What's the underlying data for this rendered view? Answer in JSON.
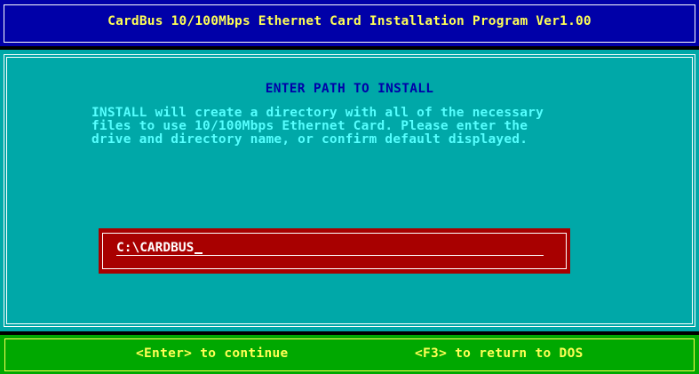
{
  "window": {
    "title": "CardBus 10/100Mbps Ethernet Card Installation Program Ver1.00"
  },
  "main": {
    "heading": "ENTER PATH TO INSTALL",
    "description_lines": [
      "INSTALL will create a directory with all of the necessary",
      "files to use 10/100Mbps Ethernet Card. Please enter the",
      "drive and directory name, or confirm default displayed."
    ],
    "path_input": {
      "value": "C:\\CARDBUS"
    }
  },
  "footer": {
    "continue_label": "<Enter> to continue",
    "dos_label": "<F3> to return to DOS"
  },
  "colors": {
    "title_bg": "#0000a8",
    "title_text": "#ffff55",
    "panel_bg": "#00a8a8",
    "heading_text": "#0000a8",
    "description_text": "#55ffff",
    "input_bg": "#a80000",
    "input_text": "#ffffff",
    "footer_bg": "#00a800",
    "footer_text": "#ffff55"
  },
  "icons": {
    "cursor": "text-cursor-underscore"
  }
}
